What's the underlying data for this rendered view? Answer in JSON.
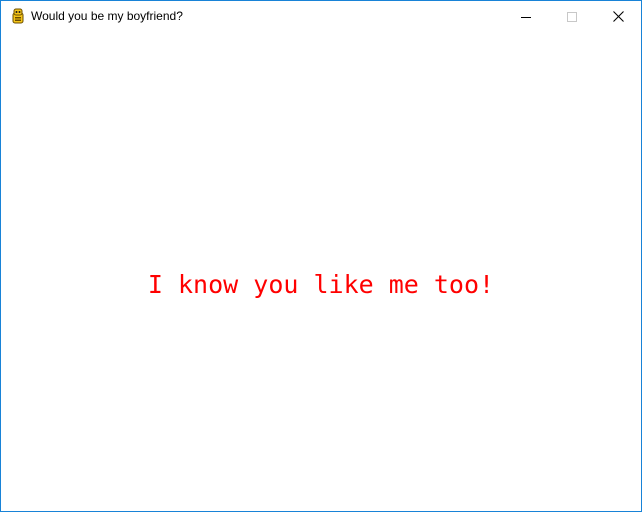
{
  "window": {
    "title": "Would you be my boyfriend?",
    "app_icon": "pygame-snake-icon",
    "border_color": "#1883d7"
  },
  "caption_buttons": {
    "minimize_icon": "minimize-icon",
    "maximize_icon": "maximize-icon",
    "close_icon": "close-icon"
  },
  "content": {
    "message": "I know you like me too!",
    "message_color": "#ff0000",
    "background_color": "#ffffff"
  }
}
